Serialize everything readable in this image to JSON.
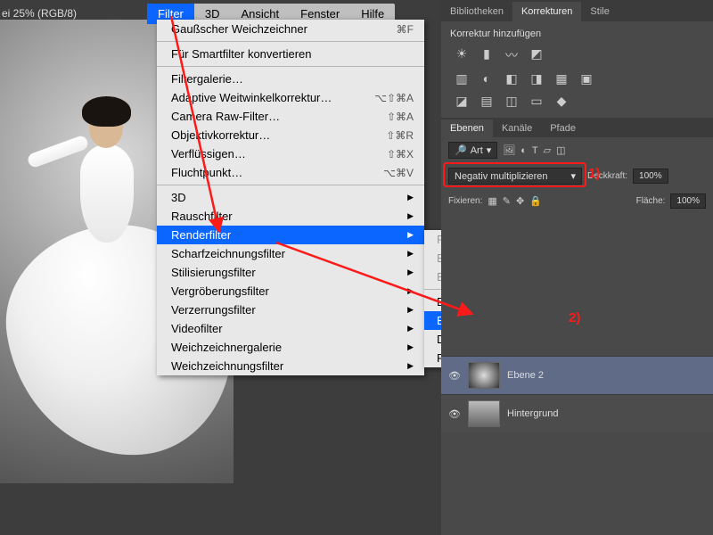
{
  "title_hint": "ei 25% (RGB/8)",
  "menubar": {
    "items": [
      "Filter",
      "3D",
      "Ansicht",
      "Fenster",
      "Hilfe"
    ],
    "selected": 0
  },
  "dropdown": {
    "last": {
      "label": "Gaußscher Weichzeichner",
      "shortcut": "⌘F"
    },
    "smart": "Für Smartfilter konvertieren",
    "gallery": "Filtergalerie…",
    "adaptive": {
      "label": "Adaptive Weitwinkelkorrektur…",
      "shortcut": "⌥⇧⌘A"
    },
    "cameraraw": {
      "label": "Camera Raw-Filter…",
      "shortcut": "⇧⌘A"
    },
    "lens": {
      "label": "Objektivkorrektur…",
      "shortcut": "⇧⌘R"
    },
    "liquify": {
      "label": "Verflüssigen…",
      "shortcut": "⇧⌘X"
    },
    "vanish": {
      "label": "Fluchtpunkt…",
      "shortcut": "⌥⌘V"
    },
    "subs": [
      "3D",
      "Rauschfilter",
      "Renderfilter",
      "Scharfzeichnungsfilter",
      "Stilisierungsfilter",
      "Vergröberungsfilter",
      "Verzerrungsfilter",
      "Videofilter",
      "Weichzeichnergalerie",
      "Weichzeichnungsfilter"
    ],
    "selected_sub": 2
  },
  "submenu": {
    "dim": [
      "Flamme…",
      "Bilderrahmen…",
      "Baum…"
    ],
    "items": [
      "Beleuchtungseffekte…",
      "Blendenflecke…",
      "Differenz-Wolken",
      "Fasern…"
    ],
    "selected": 1
  },
  "panel_tabs": [
    "Bibliotheken",
    "Korrekturen",
    "Stile"
  ],
  "panel_tabs_selected": 1,
  "korr_title": "Korrektur hinzufügen",
  "layer_tabs": [
    "Ebenen",
    "Kanäle",
    "Pfade"
  ],
  "layer_tabs_selected": 0,
  "layer_search": {
    "label": "Art",
    "value": "Art"
  },
  "blend": {
    "value": "Negativ multiplizieren",
    "opacity_label": "Deckkraft:",
    "opacity": "100%"
  },
  "lock": {
    "label": "Fixieren:",
    "fill_label": "Fläche:",
    "fill": "100%"
  },
  "layers": [
    {
      "name": "Ebene 2",
      "selected": true,
      "thumb": "grad"
    },
    {
      "name": "Hintergrund",
      "selected": false,
      "thumb": "person"
    }
  ],
  "annot": {
    "one": "1)",
    "two": "2)"
  }
}
